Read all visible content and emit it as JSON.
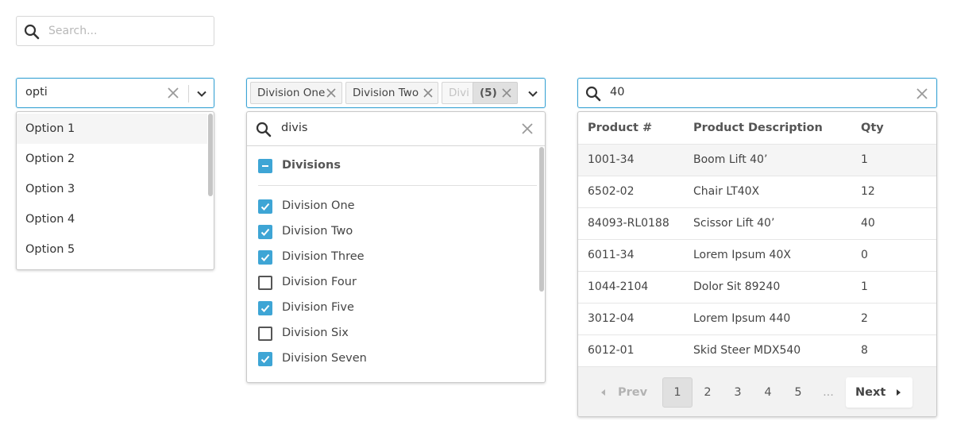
{
  "top_search": {
    "placeholder": "Search..."
  },
  "combobox": {
    "value": "opti",
    "options": [
      "Option 1",
      "Option 2",
      "Option 3",
      "Option 4",
      "Option 5"
    ],
    "highlighted_index": 0
  },
  "multiselect": {
    "chips": [
      "Division One",
      "Division Two",
      "Divi"
    ],
    "overflow_count": "(5)",
    "search_query": "divis",
    "group": {
      "label": "Divisions",
      "state": "indeterminate"
    },
    "items": [
      {
        "label": "Division One",
        "checked": true
      },
      {
        "label": "Division Two",
        "checked": true
      },
      {
        "label": "Division Three",
        "checked": true
      },
      {
        "label": "Division Four",
        "checked": false
      },
      {
        "label": "Division Five",
        "checked": true
      },
      {
        "label": "Division Six",
        "checked": false
      },
      {
        "label": "Division Seven",
        "checked": true
      }
    ]
  },
  "product_lookup": {
    "query": "40",
    "columns": [
      "Product #",
      "Product Description",
      "Qty"
    ],
    "rows": [
      [
        "1001-34",
        "Boom Lift 40’",
        "1"
      ],
      [
        "6502-02",
        "Chair LT40X",
        "12"
      ],
      [
        "84093-RL0188",
        "Scissor Lift 40’",
        "40"
      ],
      [
        "6011-34",
        "Lorem Ipsum 40X",
        "0"
      ],
      [
        "1044-2104",
        "Dolor Sit 89240",
        "1"
      ],
      [
        "3012-04",
        "Lorem Ipsum 440",
        "2"
      ],
      [
        "6012-01",
        "Skid Steer MDX540",
        "8"
      ]
    ],
    "pagination": {
      "prev_label": "Prev",
      "next_label": "Next",
      "pages": [
        "1",
        "2",
        "3",
        "4",
        "5"
      ],
      "ellipsis": "...",
      "current": "1"
    }
  },
  "colors": {
    "accent": "#3ea5d5",
    "border": "#d6d6d6",
    "text": "#3a3a3a"
  }
}
